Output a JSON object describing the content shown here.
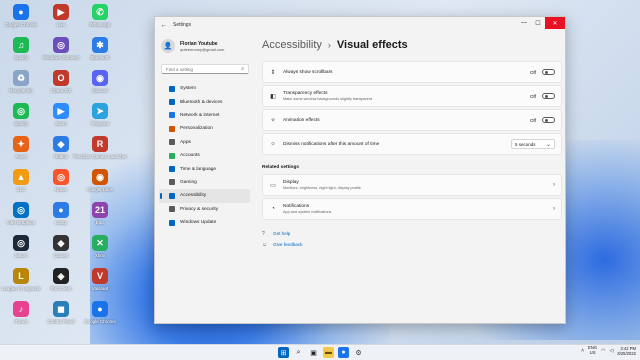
{
  "desktop": {
    "icons": [
      {
        "label": "Google Chrome",
        "color": "#1a73e8",
        "glyph": "●"
      },
      {
        "label": "Live",
        "color": "#c0392b",
        "glyph": "▶"
      },
      {
        "label": "WhatsApp",
        "color": "#25d366",
        "glyph": "✆"
      },
      {
        "label": "Spotify",
        "color": "#1db954",
        "glyph": "♫"
      },
      {
        "label": "Windows Connect",
        "color": "#6b4fbb",
        "glyph": "◎"
      },
      {
        "label": "Bluetooth",
        "color": "#2d7be5",
        "glyph": "✱"
      },
      {
        "label": "Recycle Bin",
        "color": "#8aa4c8",
        "glyph": "♻"
      },
      {
        "label": "Opera GX",
        "color": "#c0392b",
        "glyph": "O"
      },
      {
        "label": "Discord",
        "color": "#5865f2",
        "glyph": "◉"
      },
      {
        "label": "Spotify",
        "color": "#1db954",
        "glyph": "◎"
      },
      {
        "label": "Zoom",
        "color": "#2d8cff",
        "glyph": "▶"
      },
      {
        "label": "Telegram",
        "color": "#2aa3df",
        "glyph": "➤"
      },
      {
        "label": "Avast",
        "color": "#e8631a",
        "glyph": "✦"
      },
      {
        "label": "Roblox",
        "color": "#2d7be5",
        "glyph": "◆"
      },
      {
        "label": "Rockstar Games Launcher",
        "color": "#c0392b",
        "glyph": "R"
      },
      {
        "label": "VLC",
        "color": "#f39c12",
        "glyph": "▲"
      },
      {
        "label": "Brave",
        "color": "#fb542b",
        "glyph": "◎"
      },
      {
        "label": "Google Drive",
        "color": "#d35400",
        "glyph": "◉"
      },
      {
        "label": "Intel Graphics",
        "color": "#0071c5",
        "glyph": "◎"
      },
      {
        "label": "Uplay",
        "color": "#2d7be5",
        "glyph": "●"
      },
      {
        "label": "Epic",
        "color": "#8e44ad",
        "glyph": "21"
      },
      {
        "label": "Steam",
        "color": "#1b2838",
        "glyph": "◎"
      },
      {
        "label": "Games",
        "color": "#333333",
        "glyph": "◆"
      },
      {
        "label": "Xbox",
        "color": "#27ae60",
        "glyph": "✕"
      },
      {
        "label": "League of Legends",
        "color": "#b8860b",
        "glyph": "L"
      },
      {
        "label": "Riot Client",
        "color": "#222222",
        "glyph": "◈"
      },
      {
        "label": "Valorant",
        "color": "#c0392b",
        "glyph": "V"
      },
      {
        "label": "iTunes",
        "color": "#e84393",
        "glyph": "♪"
      },
      {
        "label": "Control Panel",
        "color": "#2980b9",
        "glyph": "◼"
      },
      {
        "label": "Google Chrome",
        "color": "#1a73e8",
        "glyph": "●"
      }
    ]
  },
  "window": {
    "app_title": "Settings",
    "back_glyph": "←",
    "controls": {
      "minimize": "—",
      "maximize": "☐",
      "close": "✕"
    }
  },
  "user": {
    "name": "Florian Youtube",
    "email": "quteemoney@gmail.com"
  },
  "search": {
    "placeholder": "Find a setting",
    "icon": "search-icon"
  },
  "nav": [
    {
      "label": "System",
      "color": "#0067c0"
    },
    {
      "label": "Bluetooth & devices",
      "color": "#0067c0"
    },
    {
      "label": "Network & internet",
      "color": "#1a73e8"
    },
    {
      "label": "Personalization",
      "color": "#d35400"
    },
    {
      "label": "Apps",
      "color": "#5a5a5a"
    },
    {
      "label": "Accounts",
      "color": "#27ae60"
    },
    {
      "label": "Time & language",
      "color": "#0067c0"
    },
    {
      "label": "Gaming",
      "color": "#5a5a5a"
    },
    {
      "label": "Accessibility",
      "color": "#0067c0"
    },
    {
      "label": "Privacy & security",
      "color": "#5a5a5a"
    },
    {
      "label": "Windows Update",
      "color": "#0067c0"
    }
  ],
  "breadcrumb": {
    "parent": "Accessibility",
    "separator": "›",
    "current": "Visual effects"
  },
  "settings": {
    "scrollbars": {
      "title": "Always show scrollbars",
      "state": "Off"
    },
    "transparency": {
      "title": "Transparency effects",
      "subtitle": "Make some window backgrounds slightly transparent",
      "state": "Off"
    },
    "animation": {
      "title": "Animation effects",
      "state": "Off"
    },
    "dismiss": {
      "title": "Dismiss notifications after this amount of time",
      "value": "5 seconds"
    }
  },
  "related": {
    "heading": "Related settings",
    "display": {
      "title": "Display",
      "subtitle": "Monitors, brightness, night light, display profile"
    },
    "notifications": {
      "title": "Notifications",
      "subtitle": "App and system notifications"
    }
  },
  "links": {
    "help": "Get help",
    "feedback": "Give feedback"
  },
  "taskbar": {
    "lang_top": "ENG",
    "lang_bottom": "US",
    "time": "3:42 PM",
    "date": "8/25/2022"
  }
}
